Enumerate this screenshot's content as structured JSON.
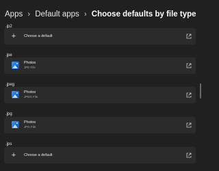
{
  "breadcrumb": {
    "items": [
      "Apps",
      "Default apps"
    ],
    "current": "Choose defaults by file type",
    "separator": "›"
  },
  "file_types": [
    {
      "extension": ".jp2",
      "action_label": "Choose a default"
    },
    {
      "extension": ".jpe",
      "app_name": "Photos",
      "app_type": "JPE File",
      "app_icon": "photos-icon"
    },
    {
      "extension": ".jpeg",
      "app_name": "Photos",
      "app_type": "JPEG File",
      "app_icon": "photos-icon"
    },
    {
      "extension": ".jpg",
      "app_name": "Photos",
      "app_type": "JPG File",
      "app_icon": "photos-icon"
    },
    {
      "extension": ".jps",
      "action_label": "Choose a default"
    }
  ],
  "icons": {
    "add": "plus-icon",
    "open": "open-external-icon",
    "app": "photos-icon"
  },
  "colors": {
    "background": "#202020",
    "card": "#2b2b2b",
    "photos_icon": "#1a7fe8"
  }
}
